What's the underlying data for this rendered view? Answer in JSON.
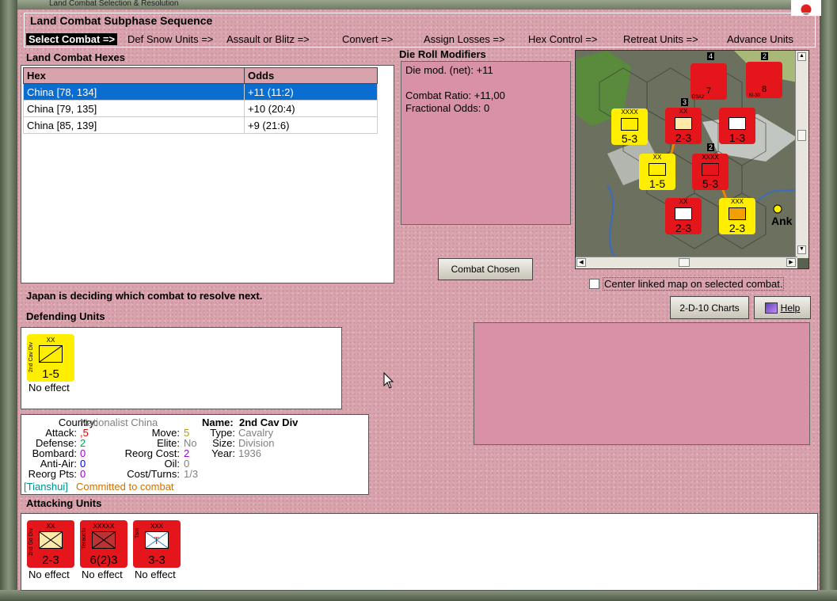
{
  "window": {
    "title": "Land Combat Selection & Resolution"
  },
  "phase": {
    "title": "Land Combat Subphase Sequence",
    "steps": [
      "Select Combat =>",
      "Def Snow Units =>",
      "Assault or Blitz =>",
      "Convert =>",
      "Assign Losses =>",
      "Hex Control =>",
      "Retreat Units =>",
      "Advance Units"
    ],
    "active_index": 0
  },
  "hexes": {
    "label": "Land Combat Hexes",
    "columns": [
      "Hex",
      "Odds"
    ],
    "rows": [
      {
        "hex": "China [78, 134]",
        "odds": "+11 (11:2)",
        "selected": true
      },
      {
        "hex": "China [79, 135]",
        "odds": "+10 (20:4)",
        "selected": false
      },
      {
        "hex": "China [85, 139]",
        "odds": "+9 (21:6)",
        "selected": false
      }
    ]
  },
  "drm": {
    "label": "Die Roll Modifiers",
    "line1": "Die mod. (net): +11",
    "line2": "Combat Ratio: +11,00",
    "line3": "Fractional Odds: 0"
  },
  "buttons": {
    "combat_chosen": "Combat Chosen",
    "charts": "2-D-10 Charts",
    "help": "Help"
  },
  "center_checkbox": {
    "label": "Center linked map on selected combat.",
    "checked": false
  },
  "status_text": "Japan is deciding which combat to resolve next.",
  "map": {
    "place_label": "Ank",
    "counters": [
      {
        "color": "yel",
        "size": "XXXX",
        "value": "5-3"
      },
      {
        "color": "red",
        "size": "XX",
        "value": "2-3"
      },
      {
        "color": "red",
        "size": "",
        "value": "1-3"
      },
      {
        "color": "yel",
        "size": "XX",
        "value": "1-5"
      },
      {
        "color": "red",
        "size": "XXXX",
        "value": "5-3"
      },
      {
        "color": "red",
        "size": "XX",
        "value": "2-3"
      },
      {
        "color": "yel",
        "size": "XXX",
        "value": "2-3"
      },
      {
        "color": "red",
        "size": "",
        "value": "7"
      },
      {
        "color": "red",
        "size": "",
        "value": "8"
      }
    ],
    "aircraft_labels": [
      "D3A2",
      "Ki-30"
    ],
    "stack_numbers": [
      "4",
      "2",
      "3",
      "2"
    ]
  },
  "defending": {
    "label": "Defending Units",
    "units": [
      {
        "name": "2nd Cav Div",
        "size": "XX",
        "value": "1-5",
        "color": "#ffee00",
        "effect": "No effect"
      }
    ]
  },
  "unit_info": {
    "country_label": "Country:",
    "country": "Nationalist China",
    "attack_label": "Attack:",
    "attack": ",5",
    "defense_label": "Defense:",
    "defense": "2",
    "bombard_label": "Bombard:",
    "bombard": "0",
    "antiair_label": "Anti-Air:",
    "antiair": "0",
    "reorgpts_label": "Reorg Pts:",
    "reorgpts": "0",
    "move_label": "Move:",
    "move": "5",
    "elite_label": "Elite:",
    "elite": "No",
    "reorgcost_label": "Reorg Cost:",
    "reorgcost": "2",
    "oil_label": "Oil:",
    "oil": "0",
    "costturns_label": "Cost/Turns:",
    "costturns": "1/3",
    "name_label": "Name:",
    "name": "2nd Cav Div",
    "type_label": "Type:",
    "type": "Cavalry",
    "size_label": "Size:",
    "size": "Division",
    "year_label": "Year:",
    "year": "1936",
    "location": "[Tianshui]",
    "status": "Committed to combat"
  },
  "attacking": {
    "label": "Attacking Units",
    "units": [
      {
        "name": "2nd Gd Div",
        "size": "XX",
        "value": "2-3",
        "color": "#e4161b",
        "effect": "No effect"
      },
      {
        "name": "Terauchi",
        "size": "XXXXX",
        "value": "6(2)3",
        "color": "#e4161b",
        "effect": "No effect"
      },
      {
        "name": "Tsm",
        "size": "XXX",
        "value": "3-3",
        "color": "#e4161b",
        "effect": "No effect"
      }
    ]
  }
}
